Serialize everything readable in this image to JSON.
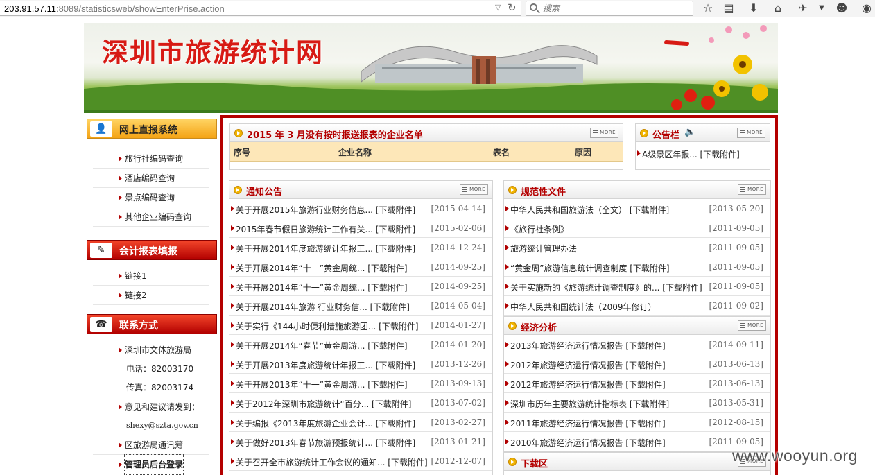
{
  "browser": {
    "url_host": "203.91.57.11",
    "url_rest": ":8089/statisticsweb/showEnterPrise.action",
    "search_placeholder": "搜索"
  },
  "site": {
    "title": "深圳市旅游统计网"
  },
  "sidebar": {
    "section1": {
      "title": "网上直报系统",
      "items": [
        "旅行社编码查询",
        "酒店编码查询",
        "景点编码查询",
        "其他企业编码查询"
      ]
    },
    "section2": {
      "title": "会计报表填报",
      "items": [
        "链接1",
        "链接2"
      ]
    },
    "section3": {
      "title": "联系方式",
      "org": "深圳市文体旅游局",
      "phone": "电话：82003170",
      "fax": "传真：82003174",
      "feedback": "意见和建议请发到：",
      "email": "shexy@szta.gov.cn",
      "directory": "区旅游局通讯薄",
      "admin_login": "管理员后台登录"
    }
  },
  "more_label": "MORE",
  "report_panel": {
    "title": "2015 年 3 月没有按时报送报表的企业名单",
    "columns": [
      "序号",
      "企业名称",
      "表名",
      "原因"
    ]
  },
  "bulletin_panel": {
    "title": "公告栏",
    "items": [
      "A级景区年报... [下载附件]"
    ]
  },
  "notice_panel": {
    "title": "通知公告",
    "items": [
      {
        "title": "关于开展2015年旅游行业财务信息... [下载附件]",
        "date": "[2015-04-14]"
      },
      {
        "title": "2015年春节假日旅游统计工作有关... [下载附件]",
        "date": "[2015-02-06]"
      },
      {
        "title": "关于开展2014年度旅游统计年报工... [下载附件]",
        "date": "[2014-12-24]"
      },
      {
        "title": "关于开展2014年“十一”黄金周统... [下载附件]",
        "date": "[2014-09-25]"
      },
      {
        "title": "关于开展2014年“十一”黄金周统... [下载附件]",
        "date": "[2014-09-25]"
      },
      {
        "title": "关于开展2014年旅游 行业财务信... [下载附件]",
        "date": "[2014-05-04]"
      },
      {
        "title": "关于实行《144小时便利措施旅游团... [下载附件]",
        "date": "[2014-01-27]"
      },
      {
        "title": "关于开展2014年“春节”黄金周游... [下载附件]",
        "date": "[2014-01-20]"
      },
      {
        "title": "关于开展2013年度旅游统计年报工... [下载附件]",
        "date": "[2013-12-26]"
      },
      {
        "title": "关于开展2013年“十一”黄金周游... [下载附件]",
        "date": "[2013-09-13]"
      },
      {
        "title": "关于2012年深圳市旅游统计“百分... [下载附件]",
        "date": "[2013-07-02]"
      },
      {
        "title": "关于编报《2013年度旅游企业会计... [下载附件]",
        "date": "[2013-02-27]"
      },
      {
        "title": "关于做好2013年春节旅游预报统计... [下载附件]",
        "date": "[2013-01-21]"
      },
      {
        "title": "关于召开全市旅游统计工作会议的通知... [下载附件]",
        "date": "[2012-12-07]"
      }
    ]
  },
  "regulation_panel": {
    "title": "规范性文件",
    "items": [
      {
        "title": "中华人民共和国旅游法（全文） [下载附件]",
        "date": "[2013-05-20]"
      },
      {
        "title": "《旅行社条例》",
        "date": "[2011-09-05]"
      },
      {
        "title": "旅游统计管理办法",
        "date": "[2011-09-05]"
      },
      {
        "title": "“黄金周”旅游信息统计调查制度 [下载附件]",
        "date": "[2011-09-05]"
      },
      {
        "title": "关于实施新的《旅游统计调查制度》的... [下载附件]",
        "date": "[2011-09-05]"
      },
      {
        "title": "中华人民共和国统计法（2009年修订）",
        "date": "[2011-09-02]"
      }
    ]
  },
  "economy_panel": {
    "title": "经济分析",
    "items": [
      {
        "title": "2013年旅游经济运行情况报告 [下载附件]",
        "date": "[2014-09-11]"
      },
      {
        "title": "2012年旅游经济运行情况报告 [下载附件]",
        "date": "[2013-06-13]"
      },
      {
        "title": "2012年旅游经济运行情况报告 [下载附件]",
        "date": "[2013-06-13]"
      },
      {
        "title": "深圳市历年主要旅游统计指标表 [下载附件]",
        "date": "[2013-05-31]"
      },
      {
        "title": "2011年旅游经济运行情况报告 [下载附件]",
        "date": "[2012-08-15]"
      },
      {
        "title": "2010年旅游经济运行情况报告 [下载附件]",
        "date": "[2011-09-05]"
      }
    ]
  },
  "download_panel": {
    "title": "下载区"
  },
  "watermark": "www.wooyun.org"
}
